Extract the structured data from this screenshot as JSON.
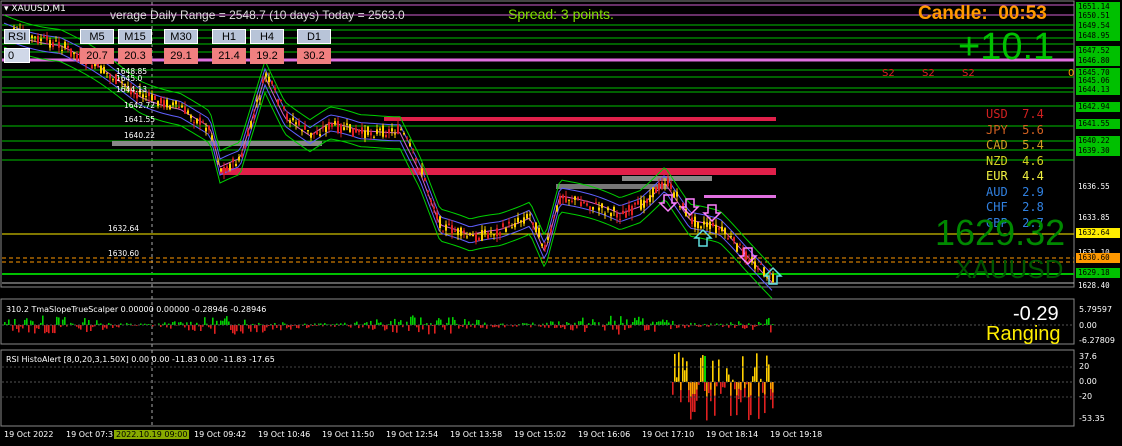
{
  "window": {
    "symbol_label": "XAUUSD,M1"
  },
  "header": {
    "range_text": "verage Daily Range = 2548.7 (10 days)   Today = 2563.0",
    "spread_text": "Spread: 3 points.",
    "candle_text": "Candle:  00:53",
    "profit_text": "+10.1",
    "s2_labels": [
      "S2",
      "S2",
      "S2"
    ],
    "right_zero": "0"
  },
  "timeframes": {
    "labels": [
      "M5",
      "M15",
      "M30",
      "H1",
      "H4",
      "D1"
    ],
    "values": [
      "20.7",
      "20.3",
      "29.1",
      "21.4",
      "19.2",
      "30.2"
    ],
    "rsi_label": "RSI",
    "rsi_value": "0"
  },
  "currencies": [
    {
      "name": "USD",
      "value": "7.4",
      "color": "#d02020"
    },
    {
      "name": "JPY",
      "value": "5.6",
      "color": "#d06020"
    },
    {
      "name": "CAD",
      "value": "5.4",
      "color": "#d0a020"
    },
    {
      "name": "NZD",
      "value": "4.6",
      "color": "#d0d020"
    },
    {
      "name": "EUR",
      "value": "4.4",
      "color": "#f0f040"
    },
    {
      "name": "AUD",
      "value": "2.9",
      "color": "#3080e0"
    },
    {
      "name": "CHF",
      "value": "2.8",
      "color": "#3080e0"
    },
    {
      "name": "GBP",
      "value": "2.7",
      "color": "#3080e0"
    }
  ],
  "big_price": "1629.32",
  "big_symbol": "XAUUSD",
  "level_labels": [
    "1648.85",
    "1645.0",
    "1644.13",
    "1642.72",
    "1641.55",
    "1640.22",
    "1632.64",
    "1630.60"
  ],
  "price_axis": [
    "1651.14",
    "1650.51",
    "1649.54",
    "1648.95",
    "1647.52",
    "1646.80",
    "1645.70",
    "1645.06",
    "1644.13",
    "1642.94",
    "1641.55",
    "1640.22",
    "1639.30",
    "1636.55",
    "1633.85",
    "1632.64",
    "1631.10",
    "1630.60",
    "1629.18",
    "1628.40"
  ],
  "indicator1": {
    "label": "310.2 TmaSlopeTrueScalper 0.00000 0.00000 -0.28946 -0.28946",
    "value": "-0.29",
    "state": "Ranging",
    "axis": [
      "5.79597",
      "0.00",
      "-6.27809"
    ]
  },
  "indicator2": {
    "label": "RSI HistoAlert [8,0,20,3,1.50X] 0.00 0.00 -11.83 0.00 -11.83 -17.65",
    "axis": [
      "37.6",
      "20",
      "0.00",
      "-20",
      "-53.35"
    ]
  },
  "time_axis": [
    "19 Oct 2022",
    "19 Oct 07:3",
    "2022.10.19 09:00",
    "19 Oct 09:42",
    "19 Oct 10:46",
    "19 Oct 11:50",
    "19 Oct 12:54",
    "19 Oct 13:58",
    "19 Oct 15:02",
    "19 Oct 16:06",
    "19 Oct 17:10",
    "19 Oct 18:14",
    "19 Oct 19:18"
  ],
  "colors": {
    "bull": "#ffd000",
    "bear": "#e02020",
    "accent_green": "#00e000",
    "orange": "#ff9900"
  }
}
